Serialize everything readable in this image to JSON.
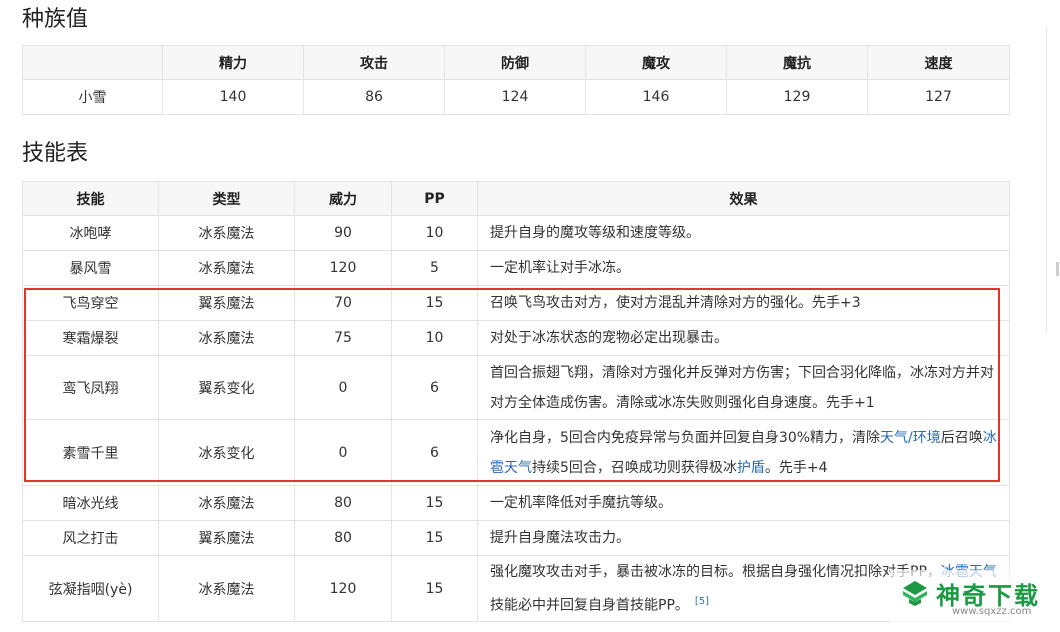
{
  "stats_section": {
    "heading": "种族值",
    "headers": [
      "",
      "精力",
      "攻击",
      "防御",
      "魔攻",
      "魔抗",
      "速度"
    ],
    "row": [
      "小雪",
      "140",
      "86",
      "124",
      "146",
      "129",
      "127"
    ]
  },
  "skills_section": {
    "heading": "技能表",
    "headers": [
      "技能",
      "类型",
      "威力",
      "PP",
      "效果"
    ],
    "rows": [
      {
        "name": "冰咆哮",
        "type": "冰系魔法",
        "power": "90",
        "pp": "10",
        "effect": "提升自身的魔攻等级和速度等级。"
      },
      {
        "name": "暴风雪",
        "type": "冰系魔法",
        "power": "120",
        "pp": "5",
        "effect": "一定机率让对手冰冻。"
      },
      {
        "name": "飞鸟穿空",
        "type": "翼系魔法",
        "power": "70",
        "pp": "15",
        "effect": "召唤飞鸟攻击对方，使对方混乱并清除对方的强化。先手+3"
      },
      {
        "name": "寒霜爆裂",
        "type": "冰系魔法",
        "power": "75",
        "pp": "10",
        "effect": "对处于冰冻状态的宠物必定出现暴击。"
      },
      {
        "name": "鸾飞凤翔",
        "type": "翼系变化",
        "power": "0",
        "pp": "6",
        "effect": "首回合振翅飞翔，清除对方强化并反弹对方伤害；下回合羽化降临，冰冻对方并对对方全体造成伤害。清除或冰冻失败则强化自身速度。先手+1"
      },
      {
        "name": "素雪千里",
        "type": "冰系变化",
        "power": "0",
        "pp": "6",
        "effect_parts": [
          "净化自身，5回合内免疫异常与负面并回复自身30%精力，清除",
          "天气/环境",
          "后召唤",
          "冰雹天气",
          "持续5回合，召唤成功则获得极冰",
          "护盾",
          "。先手+4"
        ]
      },
      {
        "name": "暗冰光线",
        "type": "冰系魔法",
        "power": "80",
        "pp": "15",
        "effect": "一定机率降低对手魔抗等级。"
      },
      {
        "name": "风之打击",
        "type": "翼系魔法",
        "power": "80",
        "pp": "15",
        "effect": "提升自身魔法攻击力。"
      },
      {
        "name": "弦凝指咽(yè)",
        "type": "冰系魔法",
        "power": "120",
        "pp": "15",
        "effect_parts": [
          "强化魔攻攻击对手，暴击被冰冻的目标。根据自身强化情况扣除对手P",
          "P，",
          "冰雹天气",
          "技能必中并回复自身首技能PP。"
        ],
        "ref": "[5]"
      }
    ]
  },
  "watermark": {
    "text": "神奇下载",
    "url": "www.sqxzz.com"
  }
}
